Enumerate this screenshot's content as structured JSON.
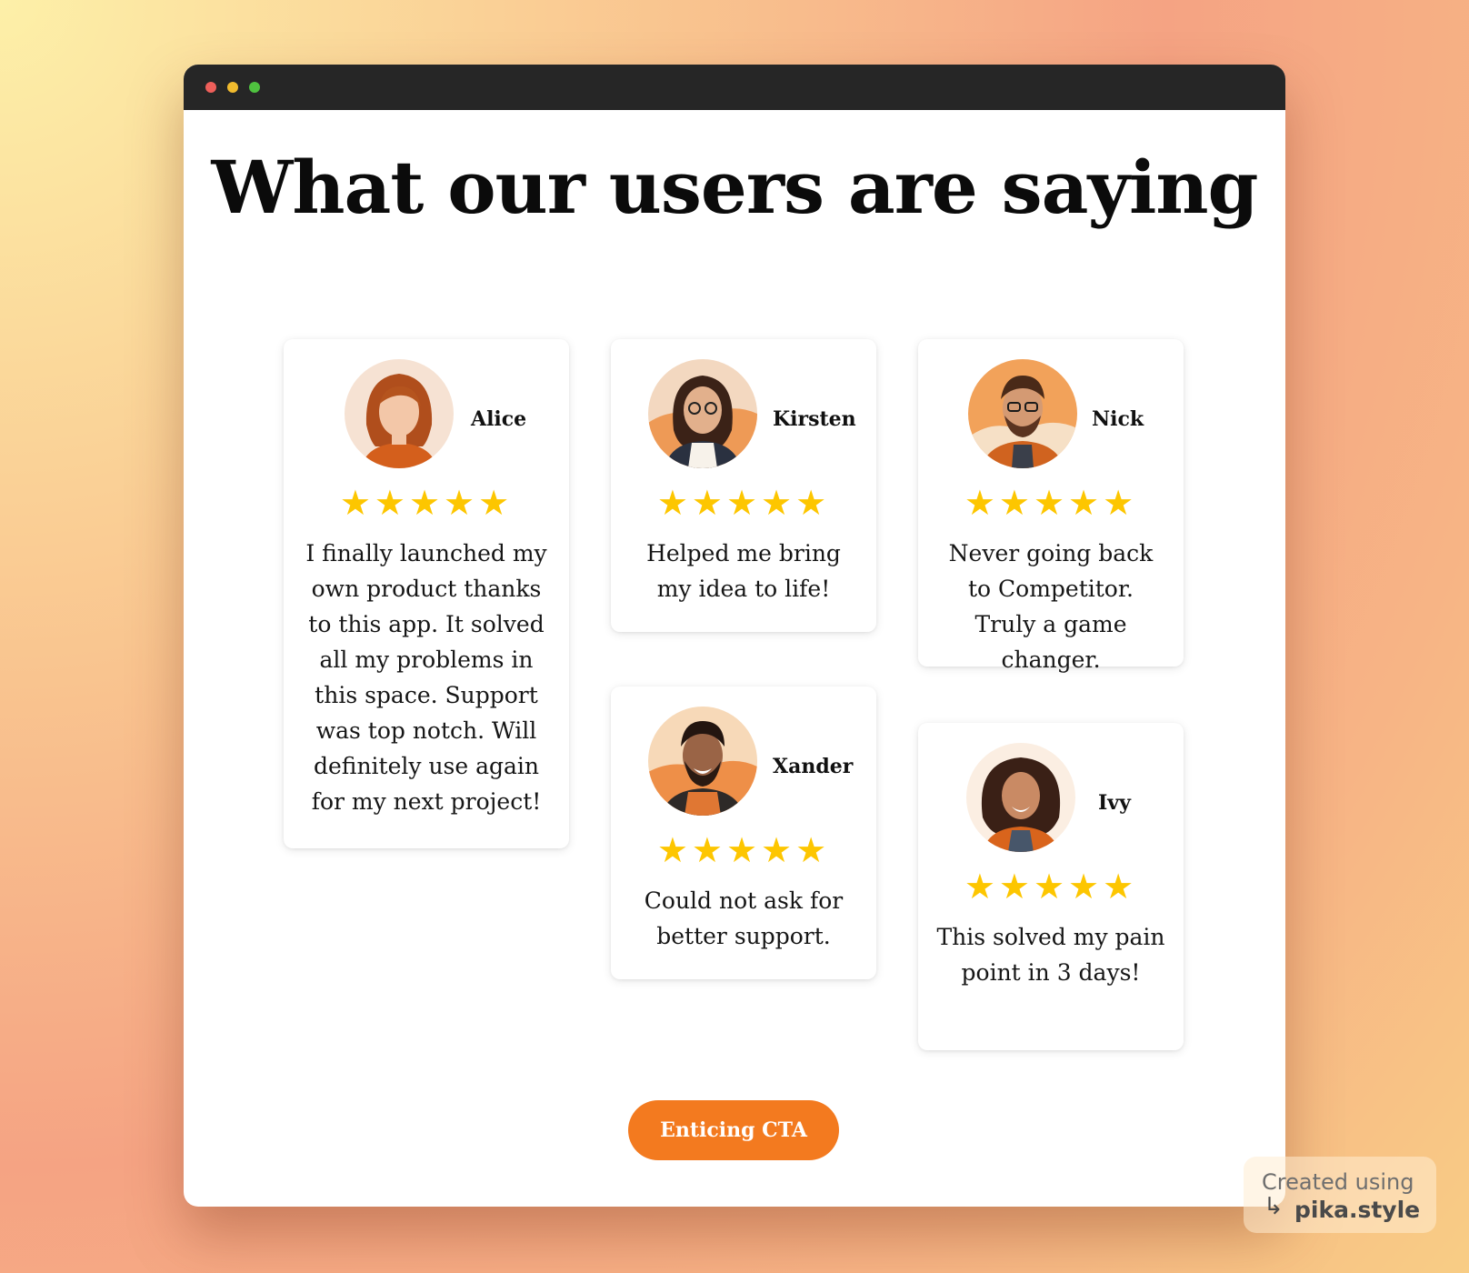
{
  "heading": "What our users are saying",
  "testimonials": [
    {
      "name": "Alice",
      "rating": 5,
      "stars": "★★★★★",
      "quote": "I finally launched my own product thanks to this app. It solved all my problems in this space. Support was top notch. Will definitely use again for my next project!"
    },
    {
      "name": "Kirsten",
      "rating": 5,
      "stars": "★★★★★",
      "quote": "Helped me bring my idea to life!"
    },
    {
      "name": "Nick",
      "rating": 5,
      "stars": "★★★★★",
      "quote": "Never going back to Competitor. Truly a game changer."
    },
    {
      "name": "Xander",
      "rating": 5,
      "stars": "★★★★★",
      "quote": "Could not ask for better support."
    },
    {
      "name": "Ivy",
      "rating": 5,
      "stars": "★★★★★",
      "quote": "This solved my pain point in 3 days!"
    }
  ],
  "cta_label": "Enticing CTA",
  "watermark": {
    "line1": "Created using",
    "line2": "pika.style",
    "arrow_icon": "return-arrow-icon"
  },
  "colors": {
    "accent": "#f37a1f",
    "star": "#fdc600",
    "titlebar": "#262626"
  }
}
